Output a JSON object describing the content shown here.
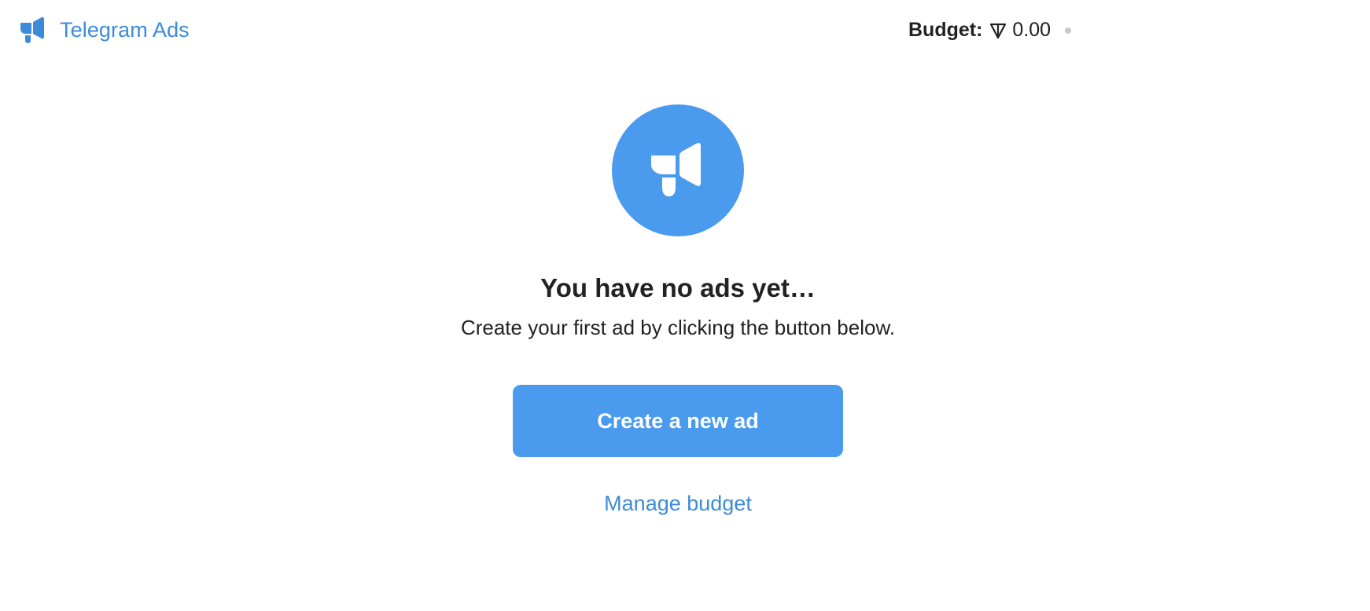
{
  "header": {
    "brand_name": "Telegram Ads",
    "budget_label": "Budget:",
    "budget_value": "0.00",
    "currency_icon": "ton-icon"
  },
  "empty_state": {
    "icon": "megaphone-icon",
    "title": "You have no ads yet…",
    "subtitle": "Create your first ad by clicking the button below.",
    "create_button_label": "Create a new ad",
    "manage_link_label": "Manage budget"
  },
  "colors": {
    "accent": "#4a9aed",
    "link": "#3d8bd8",
    "text": "#222222",
    "status_dot": "#c8c8c8"
  }
}
